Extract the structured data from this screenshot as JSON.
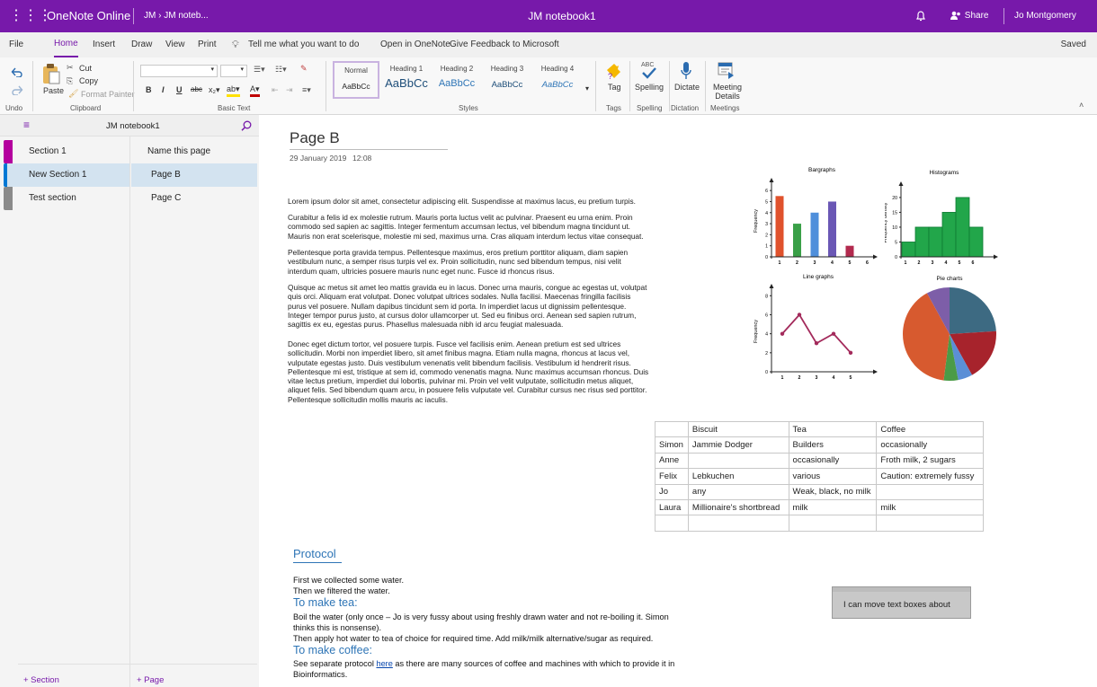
{
  "app": {
    "name": "OneNote Online",
    "breadcrumb": "JM › JM noteb...",
    "notebook_title": "JM notebook1",
    "share_label": "Share",
    "user": "Jo Montgomery"
  },
  "menu": {
    "tabs": [
      "File",
      "Home",
      "Insert",
      "Draw",
      "View",
      "Print"
    ],
    "tell_me": "Tell me what you want to do",
    "open_in": "Open in OneNote",
    "feedback": "Give Feedback to Microsoft",
    "status": "Saved"
  },
  "ribbon": {
    "undo_group": "Undo",
    "clipboard_group": "Clipboard",
    "paste": "Paste",
    "cut": "Cut",
    "copy": "Copy",
    "format_painter": "Format Painter",
    "basic_text_group": "Basic Text",
    "styles_group": "Styles",
    "styles": [
      {
        "name": "Normal",
        "preview": "AaBbCc"
      },
      {
        "name": "Heading 1",
        "preview": "AaBbCc"
      },
      {
        "name": "Heading 2",
        "preview": "AaBbCc"
      },
      {
        "name": "Heading 3",
        "preview": "AaBbCc"
      },
      {
        "name": "Heading 4",
        "preview": "AaBbCc"
      }
    ],
    "tag": "Tag",
    "tags_group": "Tags",
    "spelling": "Spelling",
    "spelling_group": "Spelling",
    "dictate": "Dictate",
    "dictation_group": "Dictation",
    "meeting_details": "Meeting Details",
    "meetings_group": "Meetings",
    "accent": "#7719aa"
  },
  "nav": {
    "notebook": "JM notebook1",
    "sections": [
      {
        "label": "Section 1",
        "color": "#b4009e"
      },
      {
        "label": "New Section 1",
        "color": "#0078d4"
      },
      {
        "label": "Test section",
        "color": "#8a8a8a"
      }
    ],
    "pages": [
      "Name this page",
      "Page B",
      "Page C"
    ],
    "add_section": "+ Section",
    "add_page": "+ Page"
  },
  "page": {
    "title": "Page B",
    "date": "29 January 2019",
    "time": "12:08",
    "paragraphs": [
      [
        "Lorem ipsum dolor sit amet, consectetur adipiscing elit. Suspendisse at maximus lacus, eu pretium turpis."
      ],
      [
        "Curabitur a felis id ex molestie rutrum. Mauris porta luctus velit ac pulvinar. Praesent eu urna enim. Proin",
        "commodo sed sapien ac sagittis. Integer fermentum accumsan lectus, vel bibendum magna tincidunt ut.",
        "Mauris non erat scelerisque, molestie mi sed, maximus urna. Cras aliquam interdum lectus vitae consequat."
      ],
      [
        "Pellentesque porta gravida tempus. Pellentesque maximus, eros pretium porttitor aliquam, diam sapien",
        "vestibulum nunc, a semper risus turpis vel ex. Proin sollicitudin, nunc sed bibendum tempus, nisi velit",
        "interdum quam, ultricies posuere mauris nunc eget nunc. Fusce id rhoncus risus."
      ],
      [
        "Quisque ac metus sit amet leo mattis gravida eu in lacus. Donec urna mauris, congue ac egestas ut, volutpat",
        "quis orci. Aliquam erat volutpat. Donec volutpat ultrices sodales. Nulla facilisi. Maecenas fringilla facilisis",
        "purus vel posuere. Nullam dapibus tincidunt sem id porta. In imperdiet lacus ut dignissim pellentesque.",
        "Integer tempor purus justo, at cursus dolor ullamcorper ut. Sed eu finibus orci. Aenean sed sapien rutrum,",
        "sagittis ex eu, egestas purus. Phasellus malesuada nibh id arcu feugiat malesuada."
      ],
      [
        "Donec eget dictum tortor, vel posuere turpis. Fusce vel facilisis enim. Aenean pretium est sed ultrices",
        "sollicitudin. Morbi non imperdiet libero, sit amet finibus magna. Etiam nulla magna, rhoncus at lacus vel,",
        "vulputate egestas justo. Duis vestibulum venenatis velit bibendum facilisis. Vestibulum id hendrerit risus.",
        "Pellentesque mi est, tristique at sem id, commodo venenatis magna. Nunc maximus accumsan rhoncus. Duis",
        "vitae lectus pretium, imperdiet dui lobortis, pulvinar mi. Proin vel velit vulputate, sollicitudin metus aliquet,",
        "aliquet felis. Sed bibendum quam arcu, in posuere felis vulputate vel. Curabitur cursus nec risus sed porttitor.",
        "Pellentesque sollicitudin mollis mauris ac iaculis."
      ]
    ],
    "table": {
      "header": [
        "",
        "Biscuit",
        "Tea",
        "Coffee"
      ],
      "rows": [
        [
          "Simon",
          "Jammie Dodger",
          "Builders",
          "occasionally"
        ],
        [
          "Anne",
          "",
          "occasionally",
          "Froth milk, 2 sugars"
        ],
        [
          "Felix",
          "Lebkuchen",
          "various",
          "Caution: extremely fussy"
        ],
        [
          "Jo",
          "any",
          "Weak, black, no milk",
          ""
        ],
        [
          "Laura",
          "Millionaire's shortbread",
          "milk",
          "milk"
        ],
        [
          "",
          "",
          "",
          ""
        ]
      ]
    },
    "protocol": {
      "title": "Protocol",
      "line1": "First we collected some water.",
      "line2": "Then we filtered the water.",
      "tea_heading": "To make tea:",
      "tea1": "Boil the water (only once – Jo is very fussy about using freshly drawn water and not re-boiling it. Simon",
      "tea2": "thinks this is nonsense).",
      "tea3": "Then apply hot water to tea of choice for required time. Add milk/milk alternative/sugar as required.",
      "coffee_heading": "To make coffee:",
      "coffee1_pre": "See separate protocol ",
      "coffee1_link": "here",
      "coffee1_post": " as there are many sources of coffee and machines with which to provide it in",
      "coffee2": "Bioinformatics."
    },
    "textbox": "I can move text boxes about"
  },
  "chart_data": [
    {
      "type": "bar",
      "title": "Bargraphs",
      "ylabel": "Frequency",
      "categories": [
        "1",
        "2",
        "3",
        "4",
        "5",
        "6"
      ],
      "values": [
        5.5,
        3,
        4,
        5,
        1,
        0
      ],
      "colors": [
        "#e0522c",
        "#3aa048",
        "#4f8fdb",
        "#6a57b5",
        "#b22a4e",
        "#b22a4e"
      ],
      "yticks": [
        0,
        1,
        2,
        3,
        4,
        5,
        6
      ],
      "ylim": [
        0,
        6.5
      ]
    },
    {
      "type": "bar",
      "title": "Histograms",
      "ylabel": "Frequency density",
      "categories": [
        "1",
        "2",
        "3",
        "4",
        "5",
        "6"
      ],
      "values": [
        5,
        10,
        10,
        15,
        20,
        10
      ],
      "bar_color": "#22a64a",
      "yticks": [
        0,
        5,
        10,
        15,
        20
      ],
      "ylim": [
        0,
        23
      ]
    },
    {
      "type": "line",
      "title": "Line graphs",
      "ylabel": "Frequency",
      "x": [
        1,
        2,
        3,
        4,
        5
      ],
      "y": [
        4,
        6,
        3,
        4,
        2
      ],
      "line_color": "#a32a5b",
      "yticks": [
        0,
        2,
        4,
        6,
        8
      ],
      "ylim": [
        0,
        8.5
      ]
    },
    {
      "type": "pie",
      "title": "Pie charts",
      "values": [
        24,
        18,
        5,
        5,
        40,
        8
      ],
      "colors": [
        "#3d6a82",
        "#a7232c",
        "#5b8fd6",
        "#4b9b47",
        "#d75a2f",
        "#7d5ea8"
      ]
    }
  ]
}
